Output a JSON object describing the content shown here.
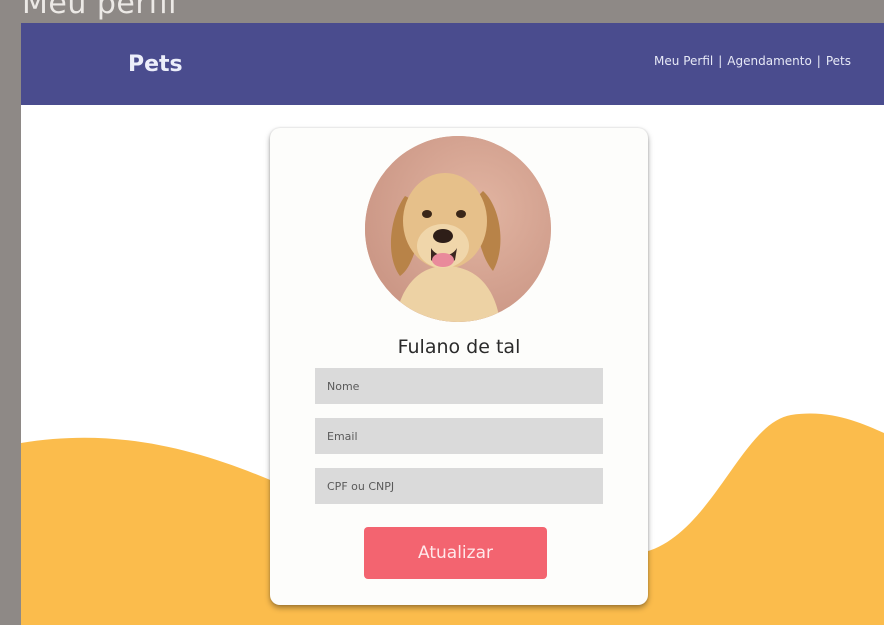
{
  "window": {
    "title": "Meu perfil"
  },
  "navbar": {
    "brand": "Pets",
    "links": [
      {
        "label": "Meu Perfil"
      },
      {
        "label": "Agendamento"
      },
      {
        "label": "Pets"
      }
    ],
    "separator": "|"
  },
  "profile": {
    "name": "Fulano de tal",
    "avatar_icon": "dog-photo",
    "fields": {
      "name": {
        "placeholder": "Nome",
        "value": ""
      },
      "email": {
        "placeholder": "Email",
        "value": ""
      },
      "cpf": {
        "placeholder": "CPF ou CNPJ",
        "value": ""
      }
    },
    "update_button": "Atualizar"
  },
  "colors": {
    "navbar": "#4a4c8e",
    "wave": "#fbbc4c",
    "button": "#f36470",
    "page_background": "#ffffff",
    "frame": "#8e8986"
  }
}
